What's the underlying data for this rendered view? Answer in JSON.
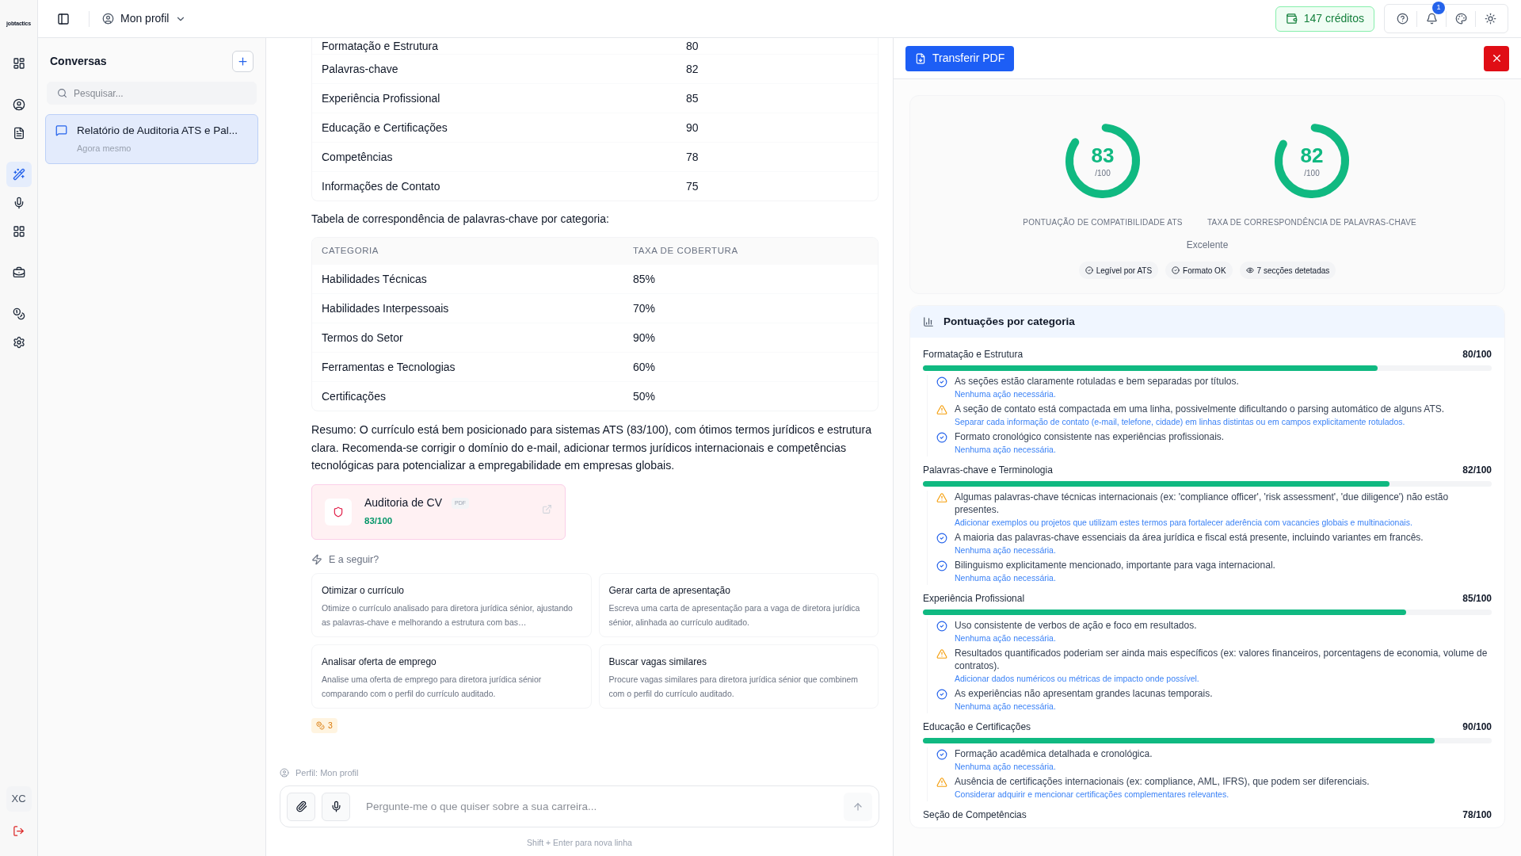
{
  "brand": "jobtactics",
  "rail": [
    {
      "selected": false
    },
    {
      "selected": false
    },
    {
      "selected": false
    },
    {
      "selected": true
    },
    {
      "selected": false
    },
    {
      "selected": false
    },
    {
      "selected": false
    },
    {
      "selected": false
    },
    {
      "selected": false
    }
  ],
  "user": {
    "initials": "XC"
  },
  "topbar": {
    "profile": "Mon profil",
    "credits": "147 créditos",
    "notifications": "1"
  },
  "conversations": {
    "title": "Conversas",
    "search_placeholder": "Pesquisar...",
    "items": [
      {
        "title": "Relatório de Auditoria ATS e Pal...",
        "time": "Agora mesmo",
        "selected": true
      }
    ]
  },
  "chat": {
    "score_rows": [
      {
        "label": "Formatação e Estrutura",
        "value": "80"
      },
      {
        "label": "Palavras-chave",
        "value": "82"
      },
      {
        "label": "Experiência Profissional",
        "value": "85"
      },
      {
        "label": "Educação e Certificações",
        "value": "90"
      },
      {
        "label": "Competências",
        "value": "78"
      },
      {
        "label": "Informações de Contato",
        "value": "75"
      }
    ],
    "keyword_intro": "Tabela de correspondência de palavras-chave por categoria:",
    "keyword_table": {
      "columns": [
        "CATEGORIA",
        "TAXA DE COBERTURA"
      ],
      "rows": [
        [
          "Habilidades Técnicas",
          "85%"
        ],
        [
          "Habilidades Interpessoais",
          "70%"
        ],
        [
          "Termos do Setor",
          "90%"
        ],
        [
          "Ferramentas e Tecnologias",
          "60%"
        ],
        [
          "Certificações",
          "50%"
        ]
      ]
    },
    "summary": "Resumo: O currículo está bem posicionado para sistemas ATS (83/100), com ótimos termos jurídicos e estrutura clara. Recomenda-se corrigir o domínio do e-mail, adicionar termos jurídicos internacionais e competências tecnológicas para potencializar a empregabilidade em empresas globais.",
    "attachment": {
      "title": "Auditoria de CV",
      "tag": "PDF",
      "score": "83/100"
    },
    "next_title": "E a seguir?",
    "suggestions": [
      {
        "title": "Otimizar o currículo",
        "description": "Otimize o currículo analisado para diretora jurídica sénior, ajustando as palavras-chave e melhorando a estrutura com bas…"
      },
      {
        "title": "Gerar carta de apresentação",
        "description": "Escreva uma carta de apresentação para a vaga de diretora jurídica sénior, alinhada ao currículo auditado."
      },
      {
        "title": "Analisar oferta de emprego",
        "description": "Analise uma oferta de emprego para diretora jurídica sénior comparando com o perfil do currículo auditado."
      },
      {
        "title": "Buscar vagas similares",
        "description": "Procure vagas similares para diretora jurídica sénior que combinem com o perfil do currículo auditado."
      }
    ],
    "cost": "3",
    "profile_hint": "Perfil: Mon profil",
    "input_placeholder": "Pergunte-me o que quiser sobre a sua carreira...",
    "input_hint": "Shift + Enter para nova linha"
  },
  "report": {
    "download": "Transferir PDF",
    "gauges": [
      {
        "value": "83",
        "max": "/100",
        "label": "PONTUAÇÃO DE COMPATIBILIDADE ATS",
        "level": 0.83
      },
      {
        "value": "82",
        "max": "/100",
        "label": "TAXA DE CORRESPONDÊNCIA DE PALAVRAS-CHAVE",
        "level": 0.82
      }
    ],
    "rating": "Excelente",
    "chips": [
      {
        "kind": "check",
        "text": "Legível por ATS"
      },
      {
        "kind": "check",
        "text": "Formato OK"
      },
      {
        "kind": "eye",
        "text": "7 secções detetadas"
      }
    ],
    "categories_title": "Pontuações por categoria",
    "sections": [
      {
        "name": "Formatação e Estrutura",
        "score": "80/100",
        "level": 0.8,
        "items": [
          {
            "kind": "ok",
            "text": "As seções estão claramente rotuladas e bem separadas por títulos.",
            "action": "Nenhuma ação necessária."
          },
          {
            "kind": "warning",
            "text": "A seção de contato está compactada em uma linha, possivelmente dificultando o parsing automático de alguns ATS.",
            "action": "Separar cada informação de contato (e-mail, telefone, cidade) em linhas distintas ou em campos explicitamente rotulados."
          },
          {
            "kind": "ok",
            "text": "Formato cronológico consistente nas experiências profissionais.",
            "action": "Nenhuma ação necessária."
          }
        ]
      },
      {
        "name": "Palavras-chave e Terminologia",
        "score": "82/100",
        "level": 0.82,
        "items": [
          {
            "kind": "warning",
            "text": "Algumas palavras-chave técnicas internacionais (ex: 'compliance officer', 'risk assessment', 'due diligence') não estão presentes.",
            "action": "Adicionar exemplos ou projetos que utilizam estes termos para fortalecer aderência com vacancies globais e multinacionais."
          },
          {
            "kind": "ok",
            "text": "A maioria das palavras-chave essenciais da área jurídica e fiscal está presente, incluindo variantes em francês.",
            "action": "Nenhuma ação necessária."
          },
          {
            "kind": "ok",
            "text": "Bilinguismo explicitamente mencionado, importante para vaga internacional.",
            "action": "Nenhuma ação necessária."
          }
        ]
      },
      {
        "name": "Experiência Profissional",
        "score": "85/100",
        "level": 0.85,
        "items": [
          {
            "kind": "ok",
            "text": "Uso consistente de verbos de ação e foco em resultados.",
            "action": "Nenhuma ação necessária."
          },
          {
            "kind": "warning",
            "text": "Resultados quantificados poderiam ser ainda mais específicos (ex: valores financeiros, porcentagens de economia, volume de contratos).",
            "action": "Adicionar dados numéricos ou métricas de impacto onde possível."
          },
          {
            "kind": "ok",
            "text": "As experiências não apresentam grandes lacunas temporais.",
            "action": "Nenhuma ação necessária."
          }
        ]
      },
      {
        "name": "Educação e Certificações",
        "score": "90/100",
        "level": 0.9,
        "items": [
          {
            "kind": "ok",
            "text": "Formação acadêmica detalhada e cronológica.",
            "action": "Nenhuma ação necessária."
          },
          {
            "kind": "warning",
            "text": "Ausência de certificações internacionais (ex: compliance, AML, IFRS), que podem ser diferenciais.",
            "action": "Considerar adquirir e mencionar certificações complementares relevantes."
          }
        ]
      },
      {
        "name": "Seção de Competências",
        "score": "78/100"
      }
    ]
  }
}
